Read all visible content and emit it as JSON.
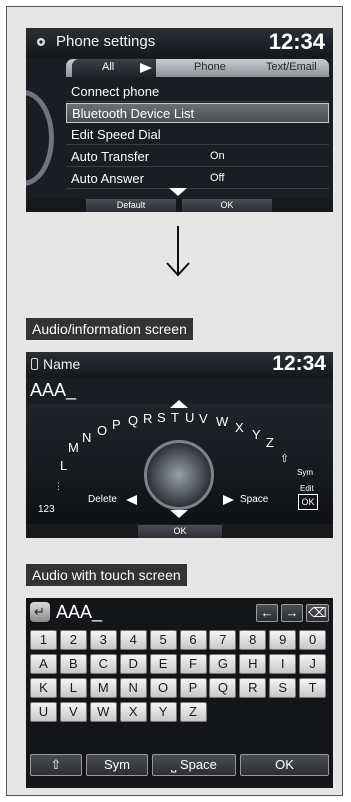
{
  "screen1": {
    "title": "Phone settings",
    "clock": "12:34",
    "tabs": [
      "All",
      "Phone",
      "Text/Email"
    ],
    "rows": [
      {
        "label": "Connect phone",
        "value": ""
      },
      {
        "label": "Bluetooth Device List",
        "value": ""
      },
      {
        "label": "Edit Speed Dial",
        "value": ""
      },
      {
        "label": "Auto Transfer",
        "value": "On"
      },
      {
        "label": "Auto Answer",
        "value": "Off"
      }
    ],
    "default_label": "Default",
    "ok_label": "OK",
    "selected_row": 1
  },
  "label_audio_info": "Audio/information screen",
  "screen2": {
    "title": "Name",
    "clock": "12:34",
    "entry": "AAA_",
    "letters": [
      "L",
      "M",
      "N",
      "O",
      "P",
      "Q",
      "R",
      "S",
      "T",
      "U",
      "V",
      "W",
      "X",
      "Y",
      "Z"
    ],
    "numbers_label": "123",
    "delete_label": "Delete",
    "space_label": "Space",
    "sym_label": "Sym",
    "edit_label": "Edit",
    "ok_label": "OK",
    "ok_bottom": "OK"
  },
  "label_touch": "Audio with touch screen",
  "screen3": {
    "entry": "AAA_",
    "back_icon": "back-icon",
    "row1": [
      "1",
      "2",
      "3",
      "4",
      "5",
      "6",
      "7",
      "8",
      "9",
      "0"
    ],
    "row2": [
      "A",
      "B",
      "C",
      "D",
      "E",
      "F",
      "G",
      "H",
      "I",
      "J"
    ],
    "row3": [
      "K",
      "L",
      "M",
      "N",
      "O",
      "P",
      "Q",
      "R",
      "S",
      "T"
    ],
    "row4": [
      "U",
      "V",
      "W",
      "X",
      "Y",
      "Z"
    ],
    "shift_label": "⇧",
    "sym_label": "Sym",
    "space_label": "Space",
    "ok_label": "OK"
  }
}
